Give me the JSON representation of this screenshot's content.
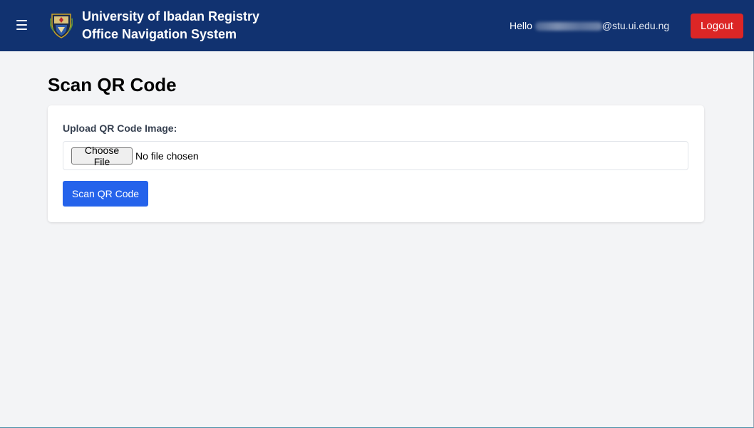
{
  "header": {
    "title_line1": "University of Ibadan Registry",
    "title_line2": "Office Navigation System",
    "greeting": "Hello",
    "email_domain": "@stu.ui.edu.ng",
    "logout_label": "Logout",
    "menu_icon": "hamburger-menu-icon",
    "logo_icon": "university-crest-logo"
  },
  "main": {
    "page_title": "Scan QR Code",
    "upload_label": "Upload QR Code Image:",
    "choose_file_label": "Choose File",
    "file_status": "No file chosen",
    "scan_button_label": "Scan QR Code"
  },
  "colors": {
    "header_bg": "#113270",
    "logout": "#dc2626",
    "primary": "#2563eb",
    "page_bg": "#f3f4f6"
  }
}
